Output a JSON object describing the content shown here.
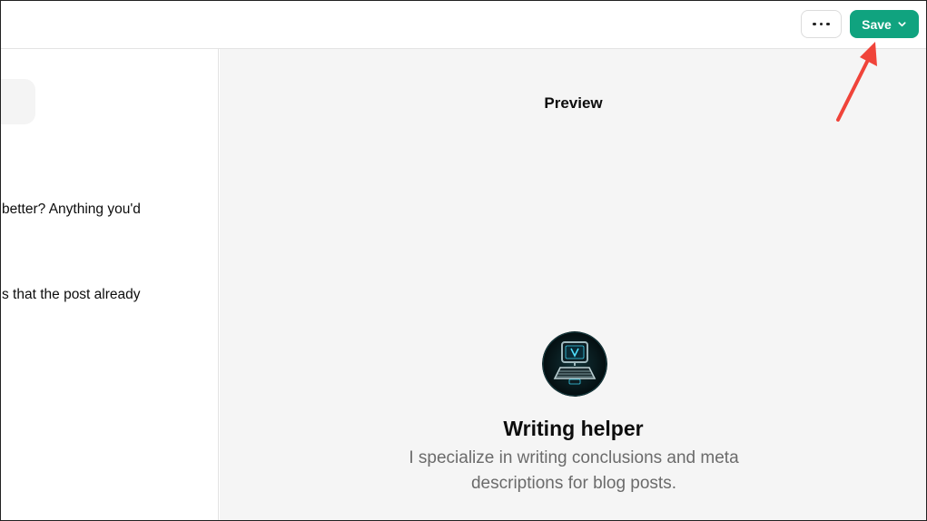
{
  "header": {
    "more_label": "More options",
    "save_label": "Save"
  },
  "editor": {
    "lines": [
      "better? Anything you'd",
      "s that the post already"
    ]
  },
  "preview": {
    "title": "Preview",
    "gpt_name": "Writing helper",
    "gpt_description": "I specialize in writing conclusions and meta descriptions for blog posts."
  },
  "colors": {
    "save_button": "#10a37f",
    "annotation_arrow": "#f0443a",
    "preview_background": "#f5f5f5"
  },
  "icons": {
    "more": "ellipsis-icon",
    "save_dropdown": "chevron-down-icon",
    "avatar": "computer-avatar-icon",
    "annotation": "red-arrow-annotation"
  }
}
